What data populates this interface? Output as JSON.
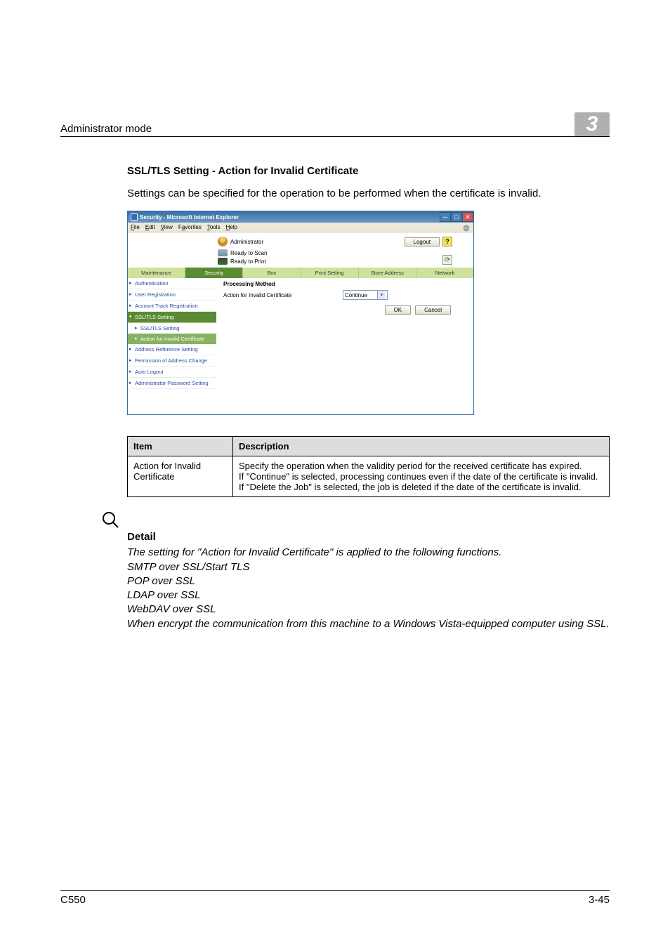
{
  "header": {
    "title": "Administrator mode",
    "chapter": "3"
  },
  "section": {
    "heading": "SSL/TLS Setting - Action for Invalid Certificate",
    "intro": "Settings can be specified for the operation to be performed when the certificate is invalid."
  },
  "window": {
    "title": "Security - Microsoft Internet Explorer",
    "menus": {
      "file": "File",
      "edit": "Edit",
      "view": "View",
      "favorites": "Favorites",
      "tools": "Tools",
      "help": "Help"
    },
    "admin_label": "Administrator",
    "logout": "Logout",
    "status": {
      "scan": "Ready to Scan",
      "print": "Ready to Print"
    },
    "tabs": {
      "maintenance": "Maintenance",
      "security": "Security",
      "box": "Box",
      "print": "Print Setting",
      "store": "Store Address",
      "network": "Network"
    },
    "sidebar": {
      "auth": "Authentication",
      "userreg": "User Registration",
      "accttrack": "Account Track Registration",
      "ssl_head": "SSL/TLS Setting",
      "ssl_sub": "SSL/TLS Setting",
      "action_sub": "Action for Invalid Certificate",
      "addrref": "Address Reference Setting",
      "permaddr": "Permission of Address Change",
      "autologout": "Auto Logout",
      "adminpw": "Administrator Password Setting"
    },
    "main": {
      "title": "Processing Method",
      "label": "Action for Invalid Certificate",
      "select_value": "Continue",
      "ok": "OK",
      "cancel": "Cancel"
    }
  },
  "table": {
    "hdr_item": "Item",
    "hdr_desc": "Description",
    "row1_item": "Action for Invalid Certificate",
    "row1_desc": "Specify the operation when the validity period for the received certificate has expired.\nIf \"Continue\" is selected, processing continues even if the date of the certificate is invalid.\nIf \"Delete the Job\" is selected, the job is deleted if the date of the certificate is invalid."
  },
  "detail": {
    "title": "Detail",
    "line1": "The setting for \"Action for Invalid Certificate\" is applied to the following functions.",
    "line2": "SMTP over SSL/Start TLS",
    "line3": "POP over SSL",
    "line4": "LDAP over SSL",
    "line5": "WebDAV over SSL",
    "line6": "When encrypt the communication from this machine to a Windows Vista-equipped computer using SSL."
  },
  "footer": {
    "model": "C550",
    "page": "3-45"
  }
}
